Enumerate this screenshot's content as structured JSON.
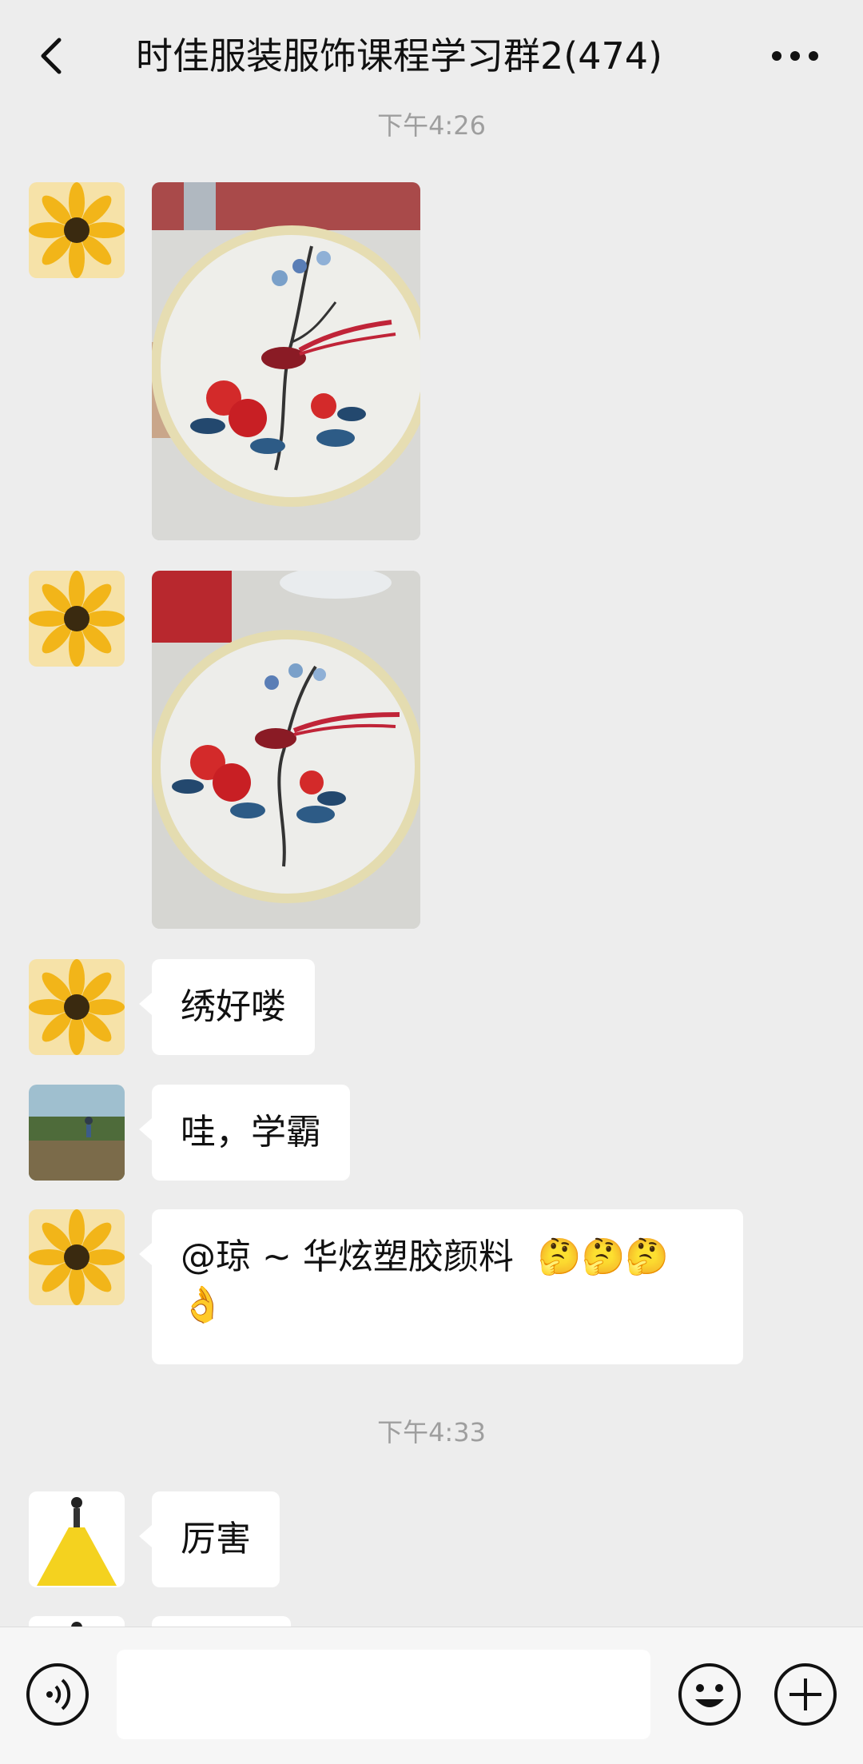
{
  "header": {
    "title": "时佳服装服饰课程学习群2(474)",
    "back_icon": "chevron-left-icon",
    "more_icon": "more-dots-icon"
  },
  "messages": {
    "time_top": "下午4:26",
    "msg3_text": "绣好喽",
    "msg4_text": "哇，学霸",
    "msg5_text": "@琼 ~ 华炫塑胶颜料",
    "msg5_emoji": "🤔🤔🤔",
    "msg5_emoji2": "👌",
    "time_mid": "下午4:33",
    "msg6_text": "厉害"
  },
  "input_bar": {
    "voice_icon": "voice-icon",
    "emoji_icon": "emoji-icon",
    "plus_icon": "plus-icon"
  },
  "colors": {
    "background": "#ededed",
    "bubble": "#ffffff",
    "accent_flower": "#f2b519"
  }
}
